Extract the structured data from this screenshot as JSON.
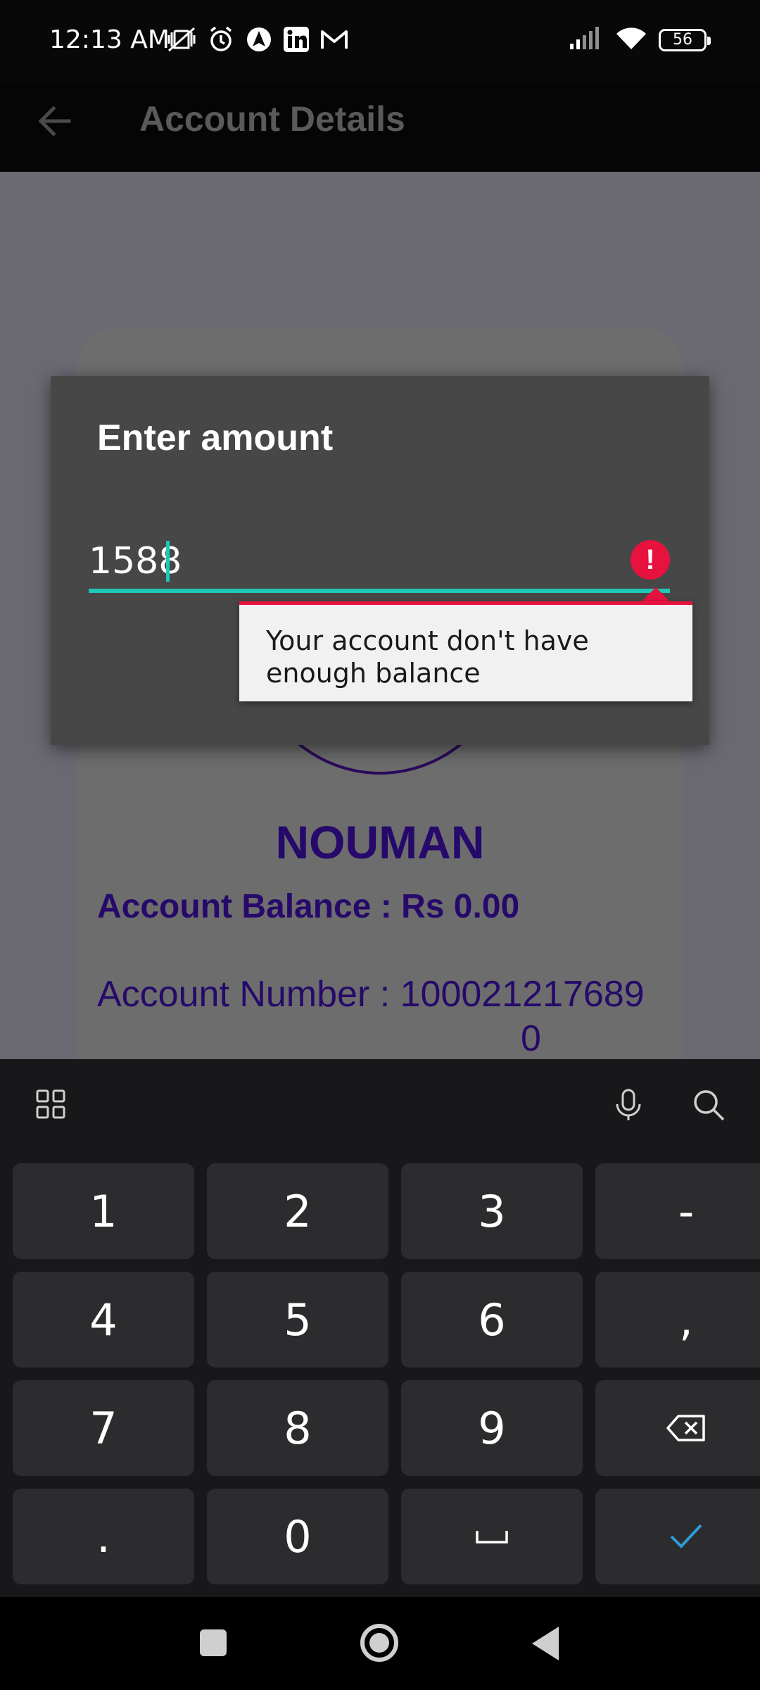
{
  "status_bar": {
    "time": "12:13 AM",
    "battery": "56",
    "icons_left": [
      "mute-vibrate-icon",
      "alarm-icon",
      "nav-app-icon",
      "linkedin-icon",
      "gmail-icon"
    ],
    "icons_right": [
      "signal-icon",
      "wifi-icon",
      "battery-icon"
    ]
  },
  "app_bar": {
    "title": "Account Details",
    "back_icon": "arrow-left-icon"
  },
  "account_card": {
    "name": "NOUMAN",
    "balance": "Account Balance : Rs 0.00",
    "account_number_line1": "Account Number : 100021217689",
    "account_number_line2": "0"
  },
  "dialog": {
    "title": "Enter amount",
    "amount_value": "1588",
    "error_message": "Your account don't have enough balance",
    "accent_color": "#1dc9b7",
    "error_color": "#e8123f"
  },
  "keyboard": {
    "toolbar_icons": [
      "grid-icon",
      "microphone-icon",
      "search-icon"
    ],
    "rows": [
      [
        "1",
        "2",
        "3",
        "-"
      ],
      [
        "4",
        "5",
        "6",
        ","
      ],
      [
        "7",
        "8",
        "9",
        "⌫"
      ],
      [
        ".",
        "0",
        "␣",
        "✓"
      ]
    ]
  },
  "nav_bar": {
    "buttons": [
      "recents-button",
      "home-button",
      "back-button"
    ]
  }
}
